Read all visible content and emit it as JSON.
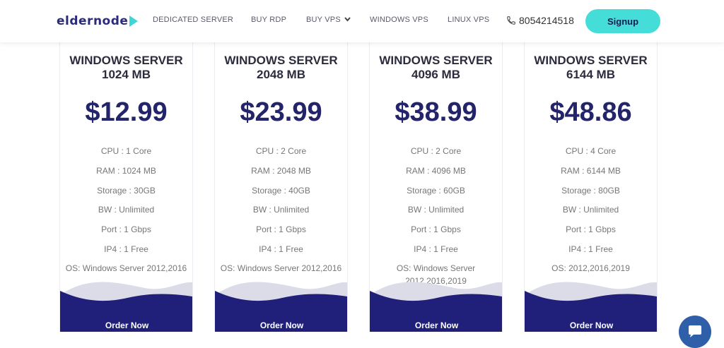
{
  "header": {
    "logo": "eldernode",
    "nav": [
      "DEDICATED SERVER",
      "BUY RDP",
      "BUY VPS",
      "WINDOWS VPS",
      "LINUX VPS"
    ],
    "phone": "8054214518",
    "signup": "Signup"
  },
  "plans": [
    {
      "title_line1": "WINDOWS SERVER",
      "title_line2": "1024 MB",
      "price": "$12.99",
      "specs": [
        "CPU : 1 Core",
        "RAM : 1024 MB",
        "Storage : 30GB",
        "BW : Unlimited",
        "Port : 1 Gbps",
        "IP4 : 1 Free",
        "OS: Windows Server 2012,2016"
      ],
      "order": "Order Now"
    },
    {
      "title_line1": "WINDOWS SERVER",
      "title_line2": "2048 MB",
      "price": "$23.99",
      "specs": [
        "CPU : 2 Core",
        "RAM : 2048 MB",
        "Storage : 40GB",
        "BW : Unlimited",
        "Port : 1 Gbps",
        "IP4 : 1 Free",
        "OS: Windows Server 2012,2016"
      ],
      "order": "Order Now"
    },
    {
      "title_line1": "WINDOWS SERVER",
      "title_line2": "4096 MB",
      "price": "$38.99",
      "specs": [
        "CPU : 2 Core",
        "RAM : 4096 MB",
        "Storage : 60GB",
        "BW : Unlimited",
        "Port : 1 Gbps",
        "IP4 : 1 Free",
        "OS: Windows Server 2012,2016,2019"
      ],
      "order": "Order Now"
    },
    {
      "title_line1": "WINDOWS SERVER",
      "title_line2": "6144 MB",
      "price": "$48.86",
      "specs": [
        "CPU : 4 Core",
        "RAM : 6144 MB",
        "Storage : 80GB",
        "BW : Unlimited",
        "Port : 1 Gbps",
        "IP4 : 1 Free",
        "OS: 2012,2016,2019"
      ],
      "order": "Order Now"
    }
  ],
  "colors": {
    "accent": "#45ddd8",
    "primary": "#20207a",
    "price": "#24246b"
  },
  "icons": [
    "phone-icon",
    "chevron-down-icon",
    "chat-icon"
  ]
}
